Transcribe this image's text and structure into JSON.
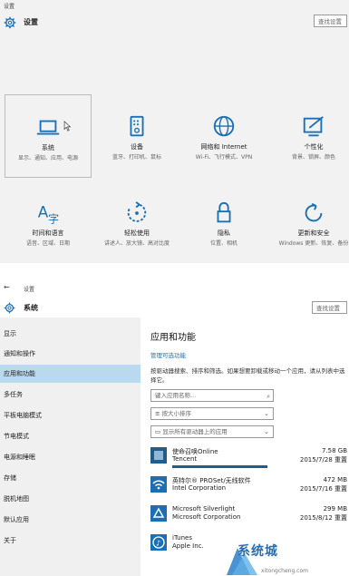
{
  "top_panel": {
    "window_title": "设置",
    "title": "设置",
    "search_placeholder": "查找设置",
    "tiles": [
      {
        "icon": "laptop-icon",
        "title": "系统",
        "desc": "显示、通知、应用、电源"
      },
      {
        "icon": "devices-icon",
        "title": "设备",
        "desc": "蓝牙、打印机、鼠标"
      },
      {
        "icon": "globe-icon",
        "title": "网络和 Internet",
        "desc": "Wi-Fi、飞行模式、VPN"
      },
      {
        "icon": "personalize-icon",
        "title": "个性化",
        "desc": "背景、锁屏、颜色"
      },
      {
        "icon": "time-language-icon",
        "title": "时间和语言",
        "desc": "语音、区域、日期"
      },
      {
        "icon": "accessibility-icon",
        "title": "轻松使用",
        "desc": "讲述人、放大镜、高对比度"
      },
      {
        "icon": "lock-icon",
        "title": "隐私",
        "desc": "位置、相机"
      },
      {
        "icon": "update-icon",
        "title": "更新和安全",
        "desc": "Windows 更新、恢复、备份"
      }
    ]
  },
  "bottom_panel": {
    "back_glyph": "←",
    "window_title": "设置",
    "title": "系统",
    "search_placeholder": "查找设置",
    "sidebar": [
      {
        "label": "显示",
        "active": false
      },
      {
        "label": "通知和操作",
        "active": false
      },
      {
        "label": "应用和功能",
        "active": true
      },
      {
        "label": "多任务",
        "active": false
      },
      {
        "label": "平板电脑模式",
        "active": false
      },
      {
        "label": "节电模式",
        "active": false
      },
      {
        "label": "电源和睡眠",
        "active": false
      },
      {
        "label": "存储",
        "active": false
      },
      {
        "label": "脱机地图",
        "active": false
      },
      {
        "label": "默认应用",
        "active": false
      },
      {
        "label": "关于",
        "active": false
      }
    ],
    "main": {
      "heading": "应用和功能",
      "link": "管理可选功能",
      "description": "按驱动器搜索、排序和筛选。如果想要卸载或移动一个应用，请从列表中选择它。",
      "search_placeholder": "键入应用名称...",
      "sort_icon": "≡",
      "sort_label": "按大小排序",
      "drive_icon": "▭",
      "drive_label": "显示所有驱动器上的应用"
    },
    "apps": [
      {
        "icon": "game-icon",
        "name": "使命召唤Online",
        "publisher": "Tencent",
        "size": "7.58 GB",
        "date": "2015/7/28 重置",
        "bar": 0.55,
        "color": "#1f5d8c"
      },
      {
        "icon": "wifi-icon",
        "name": "英特尔® PROSet/无线软件",
        "publisher": "Intel Corporation",
        "size": "472 MB",
        "date": "2015/7/16 重置",
        "bar": 0,
        "color": "#1a6fb5"
      },
      {
        "icon": "silverlight-icon",
        "name": "Microsoft Silverlight",
        "publisher": "Microsoft Corporation",
        "size": "299 MB",
        "date": "2015/8/12 重置",
        "bar": 0,
        "color": "#1a6fb5"
      },
      {
        "icon": "itunes-icon",
        "name": "iTunes",
        "publisher": "Apple Inc.",
        "size": "",
        "date": "",
        "bar": 0,
        "color": "#1a6fb5"
      }
    ],
    "watermark": {
      "text": "系统城",
      "url": "xitongcheng.com"
    }
  }
}
